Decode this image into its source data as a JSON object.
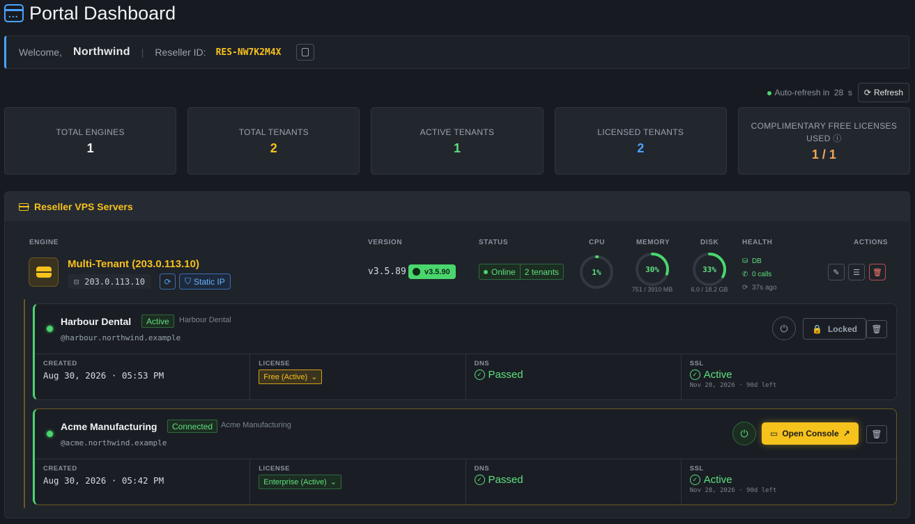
{
  "header": {
    "title": "Portal Dashboard"
  },
  "welcome": {
    "label": "Welcome,",
    "name": "Northwind",
    "separator": "|",
    "reseller_label": "Reseller ID:",
    "reseller_id": "RES-NW7K2M4X"
  },
  "refresh": {
    "label": "Auto-refresh in",
    "seconds": "28",
    "unit": "s",
    "button": "Refresh"
  },
  "stats": [
    {
      "label": "TOTAL ENGINES",
      "value": "1",
      "color": "#f1f3f6"
    },
    {
      "label": "TOTAL TENANTS",
      "value": "2",
      "color": "#f6c21c"
    },
    {
      "label": "ACTIVE TENANTS",
      "value": "1",
      "color": "#5fe07f"
    },
    {
      "label": "LICENSED TENANTS",
      "value": "2",
      "color": "#4aa3ff"
    },
    {
      "label": "COMPLIMENTARY FREE LICENSES USED ⓘ",
      "value": "1 / 1",
      "color": "#f2a55a"
    }
  ],
  "panel": {
    "title": "Reseller VPS Servers"
  },
  "columns": {
    "engine": "ENGINE",
    "version": "VERSION",
    "status": "STATUS",
    "cpu": "CPU",
    "memory": "MEMORY",
    "disk": "DISK",
    "health": "HEALTH",
    "actions": "ACTIONS"
  },
  "engine": {
    "name": "Multi-Tenant (203.0.113.10)",
    "ip": "203.0.113.10",
    "static_ip": "Static IP",
    "version": "v3.5.89",
    "latest_version": "v3.5.90",
    "status": "Online",
    "tenants": "2 tenants",
    "cpu": {
      "percent": 1,
      "label": "1%"
    },
    "memory": {
      "percent": 30,
      "label": "30%",
      "detail": "751 / 3910 MB"
    },
    "disk": {
      "percent": 33,
      "label": "33%",
      "detail": "6.0 / 18.2 GB"
    },
    "health": {
      "db": "DB",
      "calls": "0 calls",
      "ago": "37s ago"
    }
  },
  "tenants": [
    {
      "name": "Harbour Dental",
      "badge": "Active",
      "org": "Harbour Dental",
      "domain": "harbour.northwind.example",
      "action": "Locked",
      "created_label": "CREATED",
      "created": "Aug 30, 2026 · 05:53 PM",
      "license_label": "LICENSE",
      "license": "Free (Active)",
      "dns_label": "DNS",
      "dns": "Passed",
      "ssl_label": "SSL",
      "ssl": "Active",
      "ssl_sub": "Nov 28, 2026 · 90d left"
    },
    {
      "name": "Acme Manufacturing",
      "badge": "Connected",
      "org": "Acme Manufacturing",
      "domain": "acme.northwind.example",
      "action": "Open Console",
      "created_label": "CREATED",
      "created": "Aug 30, 2026 · 05:42 PM",
      "license_label": "LICENSE",
      "license": "Enterprise (Active)",
      "dns_label": "DNS",
      "dns": "Passed",
      "ssl_label": "SSL",
      "ssl": "Active",
      "ssl_sub": "Nov 28, 2026 · 90d left"
    }
  ]
}
